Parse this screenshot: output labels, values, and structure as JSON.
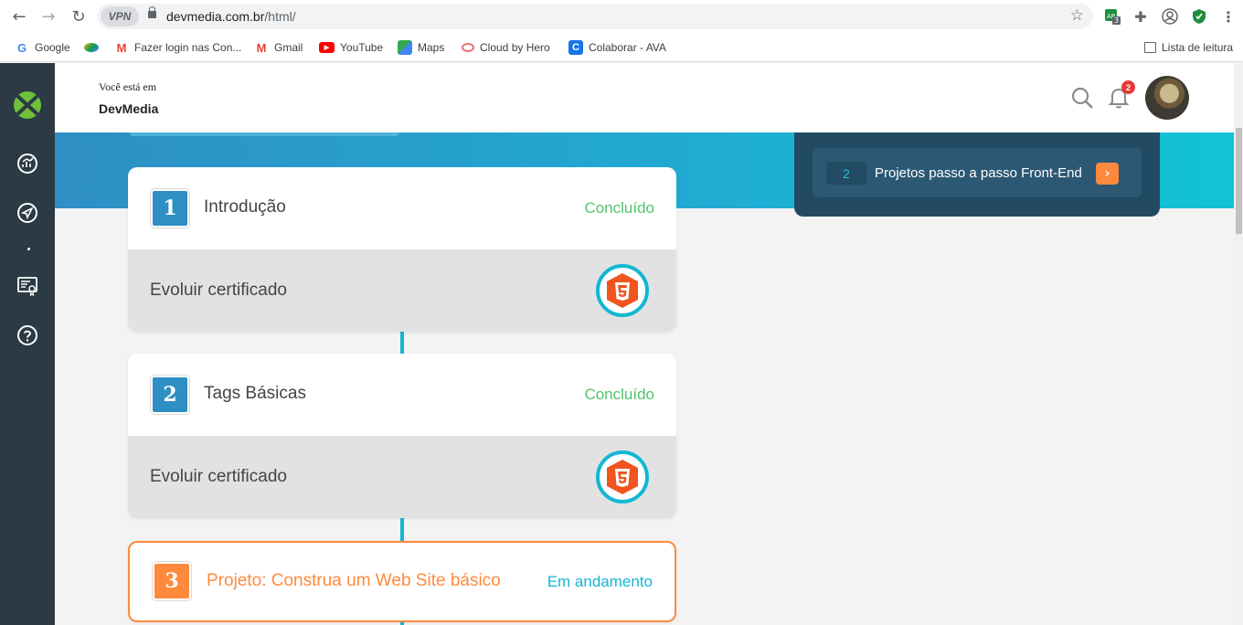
{
  "browser": {
    "vpn_label": "VPN",
    "url_host": "devmedia.com.br",
    "url_path": "/html/",
    "extension_badge": "3",
    "bookmarks": [
      {
        "label": "Google",
        "icon": "google-icon"
      },
      {
        "label": "",
        "icon": "colorful-bird-icon"
      },
      {
        "label": "Fazer login nas Con...",
        "icon": "gmail-icon"
      },
      {
        "label": "Gmail",
        "icon": "gmail-icon"
      },
      {
        "label": "YouTube",
        "icon": "youtube-icon"
      },
      {
        "label": "Maps",
        "icon": "maps-icon"
      },
      {
        "label": "Cloud by Hero",
        "icon": "cloud-icon"
      },
      {
        "label": "Colaborar - AVA",
        "icon": "colaborar-icon"
      }
    ],
    "reading_list": "Lista de leitura"
  },
  "header": {
    "you_are_in": "Você está em",
    "site_name": "DevMedia",
    "notification_count": "2"
  },
  "next_module": {
    "number": "2",
    "title": "Projetos passo a passo Front-End",
    "arrow": "›"
  },
  "modules": [
    {
      "number": "1",
      "title": "Introdução",
      "status": "Concluído",
      "cert_label": "Evoluir certificado"
    },
    {
      "number": "2",
      "title": "Tags Básicas",
      "status": "Concluído",
      "cert_label": "Evoluir certificado"
    },
    {
      "number": "3",
      "title": "Projeto: Construa um Web Site básico",
      "status": "Em andamento"
    }
  ],
  "colors": {
    "accent_blue": "#2e8fc4",
    "teal": "#13b7d3",
    "orange": "#ff8a3d",
    "done_green": "#52c46a",
    "sidebar": "#2b3a44"
  }
}
